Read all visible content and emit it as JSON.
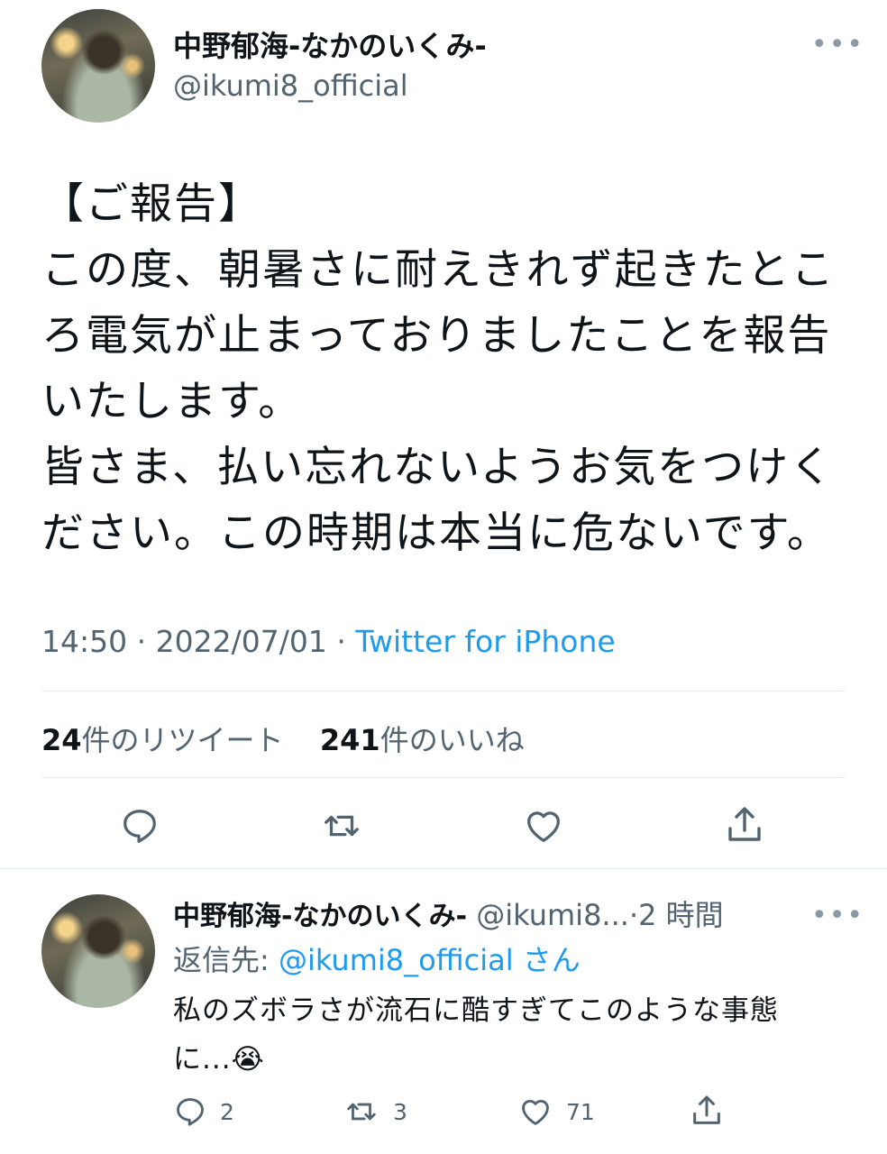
{
  "tweet": {
    "author_name": "中野郁海-なかのいくみ-",
    "author_handle": "@ikumi8_official",
    "more_label": "•••",
    "lines": [
      "【ご報告】",
      "この度、朝暑さに耐えきれず起きたとこ",
      "ろ電気が止まっておりましたことを報告",
      "いたします。",
      "皆さま、払い忘れないようお気をつけく",
      "ださい。この時期は本当に危ないです。"
    ],
    "time": "14:50",
    "separator": "·",
    "date": "2022/07/01",
    "source": "Twitter for iPhone",
    "retweet_count": "24",
    "retweet_label": "件のリツイート",
    "like_count": "241",
    "like_label": "件のいいね"
  },
  "reply": {
    "author_name": "中野郁海-なかのいくみ-",
    "author_handle": "@ikumi8...",
    "time_ago": "2 時間",
    "separator": "·",
    "more_label": "•••",
    "replying_prefix": "返信先:",
    "replying_to": "@ikumi8_official",
    "replying_suffix": "さん",
    "lines": [
      "私のズボラさが流石に酷すぎてこのような事態",
      "に..."
    ],
    "emoji": "😭",
    "reply_count": "2",
    "retweet_count": "3",
    "like_count": "71"
  },
  "icons": {
    "reply": "reply-icon",
    "retweet": "retweet-icon",
    "like": "heart-icon",
    "share": "share-icon"
  },
  "colors": {
    "link": "#1d9bf0",
    "secondary_text": "#536471",
    "divider": "#e6ecf0"
  }
}
